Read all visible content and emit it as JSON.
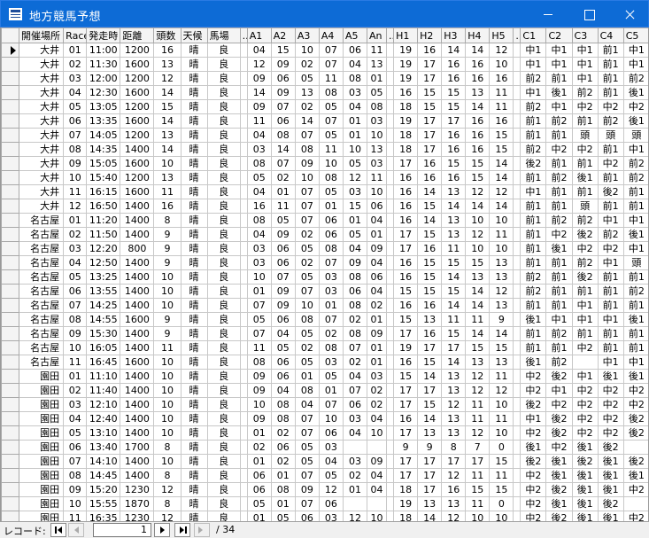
{
  "window": {
    "title": "地方競馬予想",
    "controls": {
      "minimize": "minimize",
      "maximize": "maximize",
      "close": "close"
    }
  },
  "grid": {
    "columns": [
      "開催場所",
      "Race",
      "発走時",
      "距離",
      "頭数",
      "天候",
      "馬場",
      "..",
      "A1",
      "A2",
      "A3",
      "A4",
      "A5",
      "An",
      "..",
      "H1",
      "H2",
      "H3",
      "H4",
      "H5",
      "..",
      "C1",
      "C2",
      "C3",
      "C4",
      "C5"
    ],
    "rows": [
      [
        "大井",
        "01",
        "11:00",
        "1200",
        "16",
        "晴",
        "良",
        "",
        "04",
        "15",
        "10",
        "07",
        "06",
        "11",
        "",
        "19",
        "16",
        "14",
        "14",
        "12",
        "",
        "中1",
        "中1",
        "中1",
        "前1",
        "中1"
      ],
      [
        "大井",
        "02",
        "11:30",
        "1600",
        "13",
        "晴",
        "良",
        "",
        "12",
        "09",
        "02",
        "07",
        "04",
        "13",
        "",
        "19",
        "17",
        "16",
        "16",
        "10",
        "",
        "中1",
        "中1",
        "中1",
        "前1",
        "中1"
      ],
      [
        "大井",
        "03",
        "12:00",
        "1200",
        "12",
        "晴",
        "良",
        "",
        "09",
        "06",
        "05",
        "11",
        "08",
        "01",
        "",
        "19",
        "17",
        "16",
        "16",
        "16",
        "",
        "前2",
        "前1",
        "中1",
        "前1",
        "前2"
      ],
      [
        "大井",
        "04",
        "12:30",
        "1600",
        "14",
        "晴",
        "良",
        "",
        "14",
        "09",
        "13",
        "08",
        "03",
        "05",
        "",
        "16",
        "15",
        "15",
        "13",
        "11",
        "",
        "中1",
        "後1",
        "前2",
        "前1",
        "後1"
      ],
      [
        "大井",
        "05",
        "13:05",
        "1200",
        "15",
        "晴",
        "良",
        "",
        "09",
        "07",
        "02",
        "05",
        "04",
        "08",
        "",
        "18",
        "15",
        "15",
        "14",
        "11",
        "",
        "前2",
        "中1",
        "中2",
        "中2",
        "中2"
      ],
      [
        "大井",
        "06",
        "13:35",
        "1600",
        "14",
        "晴",
        "良",
        "",
        "11",
        "06",
        "14",
        "07",
        "01",
        "03",
        "",
        "19",
        "17",
        "17",
        "16",
        "16",
        "",
        "前1",
        "前2",
        "前1",
        "前2",
        "後1"
      ],
      [
        "大井",
        "07",
        "14:05",
        "1200",
        "13",
        "晴",
        "良",
        "",
        "04",
        "08",
        "07",
        "05",
        "01",
        "10",
        "",
        "18",
        "17",
        "16",
        "16",
        "15",
        "",
        "前1",
        "前1",
        "頭",
        "頭",
        "頭"
      ],
      [
        "大井",
        "08",
        "14:35",
        "1400",
        "14",
        "晴",
        "良",
        "",
        "03",
        "14",
        "08",
        "11",
        "10",
        "13",
        "",
        "18",
        "17",
        "16",
        "16",
        "15",
        "",
        "前2",
        "中2",
        "中2",
        "前1",
        "中1"
      ],
      [
        "大井",
        "09",
        "15:05",
        "1600",
        "10",
        "晴",
        "良",
        "",
        "08",
        "07",
        "09",
        "10",
        "05",
        "03",
        "",
        "17",
        "16",
        "15",
        "15",
        "14",
        "",
        "後2",
        "前1",
        "前1",
        "中2",
        "前2"
      ],
      [
        "大井",
        "10",
        "15:40",
        "1200",
        "13",
        "晴",
        "良",
        "",
        "05",
        "02",
        "10",
        "08",
        "12",
        "11",
        "",
        "16",
        "16",
        "16",
        "15",
        "14",
        "",
        "前1",
        "前2",
        "後1",
        "前1",
        "前2"
      ],
      [
        "大井",
        "11",
        "16:15",
        "1600",
        "11",
        "晴",
        "良",
        "",
        "04",
        "01",
        "07",
        "05",
        "03",
        "10",
        "",
        "16",
        "14",
        "13",
        "12",
        "12",
        "",
        "中1",
        "前1",
        "前1",
        "後2",
        "前1"
      ],
      [
        "大井",
        "12",
        "16:50",
        "1400",
        "16",
        "晴",
        "良",
        "",
        "16",
        "11",
        "07",
        "01",
        "15",
        "06",
        "",
        "16",
        "15",
        "14",
        "14",
        "14",
        "",
        "前1",
        "前1",
        "頭",
        "前1",
        "前1"
      ],
      [
        "名古屋",
        "01",
        "11:20",
        "1400",
        "8",
        "晴",
        "良",
        "",
        "08",
        "05",
        "07",
        "06",
        "01",
        "04",
        "",
        "16",
        "14",
        "13",
        "10",
        "10",
        "",
        "前1",
        "前2",
        "前2",
        "中1",
        "中1"
      ],
      [
        "名古屋",
        "02",
        "11:50",
        "1400",
        "9",
        "晴",
        "良",
        "",
        "04",
        "09",
        "02",
        "06",
        "05",
        "01",
        "",
        "17",
        "15",
        "13",
        "12",
        "11",
        "",
        "前1",
        "中2",
        "後2",
        "前2",
        "後1"
      ],
      [
        "名古屋",
        "03",
        "12:20",
        "800",
        "9",
        "晴",
        "良",
        "",
        "03",
        "06",
        "05",
        "08",
        "04",
        "09",
        "",
        "17",
        "16",
        "11",
        "10",
        "10",
        "",
        "前1",
        "後1",
        "中2",
        "中2",
        "中1"
      ],
      [
        "名古屋",
        "04",
        "12:50",
        "1400",
        "9",
        "晴",
        "良",
        "",
        "03",
        "06",
        "02",
        "07",
        "09",
        "04",
        "",
        "16",
        "15",
        "15",
        "15",
        "13",
        "",
        "前1",
        "前1",
        "前2",
        "中1",
        "頭"
      ],
      [
        "名古屋",
        "05",
        "13:25",
        "1400",
        "10",
        "晴",
        "良",
        "",
        "10",
        "07",
        "05",
        "03",
        "08",
        "06",
        "",
        "16",
        "15",
        "14",
        "13",
        "13",
        "",
        "前2",
        "前1",
        "後2",
        "前1",
        "前1"
      ],
      [
        "名古屋",
        "06",
        "13:55",
        "1400",
        "10",
        "晴",
        "良",
        "",
        "01",
        "09",
        "07",
        "03",
        "06",
        "04",
        "",
        "15",
        "15",
        "15",
        "14",
        "12",
        "",
        "前2",
        "前1",
        "前1",
        "前1",
        "前2"
      ],
      [
        "名古屋",
        "07",
        "14:25",
        "1400",
        "10",
        "晴",
        "良",
        "",
        "07",
        "09",
        "10",
        "01",
        "08",
        "02",
        "",
        "16",
        "16",
        "14",
        "14",
        "13",
        "",
        "前1",
        "前1",
        "中1",
        "前1",
        "前1"
      ],
      [
        "名古屋",
        "08",
        "14:55",
        "1600",
        "9",
        "晴",
        "良",
        "",
        "05",
        "06",
        "08",
        "07",
        "02",
        "01",
        "",
        "15",
        "13",
        "11",
        "11",
        "9",
        "",
        "後1",
        "中1",
        "中1",
        "中1",
        "後1"
      ],
      [
        "名古屋",
        "09",
        "15:30",
        "1400",
        "9",
        "晴",
        "良",
        "",
        "07",
        "04",
        "05",
        "02",
        "08",
        "09",
        "",
        "17",
        "16",
        "15",
        "14",
        "14",
        "",
        "前1",
        "前2",
        "前1",
        "前1",
        "前1"
      ],
      [
        "名古屋",
        "10",
        "16:05",
        "1400",
        "11",
        "晴",
        "良",
        "",
        "11",
        "05",
        "02",
        "08",
        "07",
        "01",
        "",
        "19",
        "17",
        "17",
        "15",
        "15",
        "",
        "前1",
        "前1",
        "中2",
        "前1",
        "前1"
      ],
      [
        "名古屋",
        "11",
        "16:45",
        "1600",
        "10",
        "晴",
        "良",
        "",
        "08",
        "06",
        "05",
        "03",
        "02",
        "01",
        "",
        "16",
        "15",
        "14",
        "13",
        "13",
        "",
        "後1",
        "前2",
        "",
        "中1",
        "中1"
      ],
      [
        "園田",
        "01",
        "11:10",
        "1400",
        "10",
        "晴",
        "良",
        "",
        "09",
        "06",
        "01",
        "05",
        "04",
        "03",
        "",
        "15",
        "14",
        "13",
        "12",
        "11",
        "",
        "中2",
        "後2",
        "中1",
        "後1",
        "後1"
      ],
      [
        "園田",
        "02",
        "11:40",
        "1400",
        "10",
        "晴",
        "良",
        "",
        "09",
        "04",
        "08",
        "01",
        "07",
        "02",
        "",
        "17",
        "17",
        "13",
        "12",
        "12",
        "",
        "中2",
        "中1",
        "中2",
        "中2",
        "中2"
      ],
      [
        "園田",
        "03",
        "12:10",
        "1400",
        "10",
        "晴",
        "良",
        "",
        "10",
        "08",
        "04",
        "07",
        "06",
        "02",
        "",
        "17",
        "15",
        "12",
        "11",
        "10",
        "",
        "後2",
        "中2",
        "中2",
        "中2",
        "中2"
      ],
      [
        "園田",
        "04",
        "12:40",
        "1400",
        "10",
        "晴",
        "良",
        "",
        "09",
        "08",
        "07",
        "10",
        "03",
        "04",
        "",
        "16",
        "14",
        "13",
        "11",
        "11",
        "",
        "中1",
        "後2",
        "中2",
        "中2",
        "後2"
      ],
      [
        "園田",
        "05",
        "13:10",
        "1400",
        "10",
        "晴",
        "良",
        "",
        "01",
        "02",
        "07",
        "06",
        "04",
        "10",
        "",
        "17",
        "13",
        "13",
        "12",
        "10",
        "",
        "中2",
        "後2",
        "中2",
        "中2",
        "後2"
      ],
      [
        "園田",
        "06",
        "13:40",
        "1700",
        "8",
        "晴",
        "良",
        "",
        "02",
        "06",
        "05",
        "03",
        "",
        "",
        "",
        "9",
        "9",
        "8",
        "7",
        "0",
        "",
        "後1",
        "中2",
        "後1",
        "後2",
        ""
      ],
      [
        "園田",
        "07",
        "14:10",
        "1400",
        "10",
        "晴",
        "良",
        "",
        "01",
        "02",
        "05",
        "04",
        "03",
        "09",
        "",
        "17",
        "17",
        "17",
        "17",
        "15",
        "",
        "後2",
        "後1",
        "後2",
        "後1",
        "後2"
      ],
      [
        "園田",
        "08",
        "14:45",
        "1400",
        "8",
        "晴",
        "良",
        "",
        "06",
        "01",
        "07",
        "05",
        "02",
        "04",
        "",
        "17",
        "17",
        "12",
        "11",
        "11",
        "",
        "中2",
        "後1",
        "後1",
        "後1",
        "後1"
      ],
      [
        "園田",
        "09",
        "15:20",
        "1230",
        "12",
        "晴",
        "良",
        "",
        "06",
        "08",
        "09",
        "12",
        "01",
        "04",
        "",
        "18",
        "17",
        "16",
        "15",
        "15",
        "",
        "中2",
        "後2",
        "後1",
        "後1",
        "中2"
      ],
      [
        "園田",
        "10",
        "15:55",
        "1870",
        "8",
        "晴",
        "良",
        "",
        "05",
        "01",
        "07",
        "06",
        "",
        "",
        "",
        "19",
        "13",
        "13",
        "11",
        "0",
        "",
        "中2",
        "後1",
        "後1",
        "後2",
        ""
      ],
      [
        "園田",
        "11",
        "16:35",
        "1230",
        "12",
        "晴",
        "良",
        "",
        "01",
        "05",
        "06",
        "03",
        "12",
        "10",
        "",
        "18",
        "14",
        "12",
        "10",
        "10",
        "",
        "中2",
        "後2",
        "後1",
        "後1",
        "中2"
      ]
    ]
  },
  "navigator": {
    "label": "レコード:",
    "current": "1",
    "total": "/ 34"
  }
}
